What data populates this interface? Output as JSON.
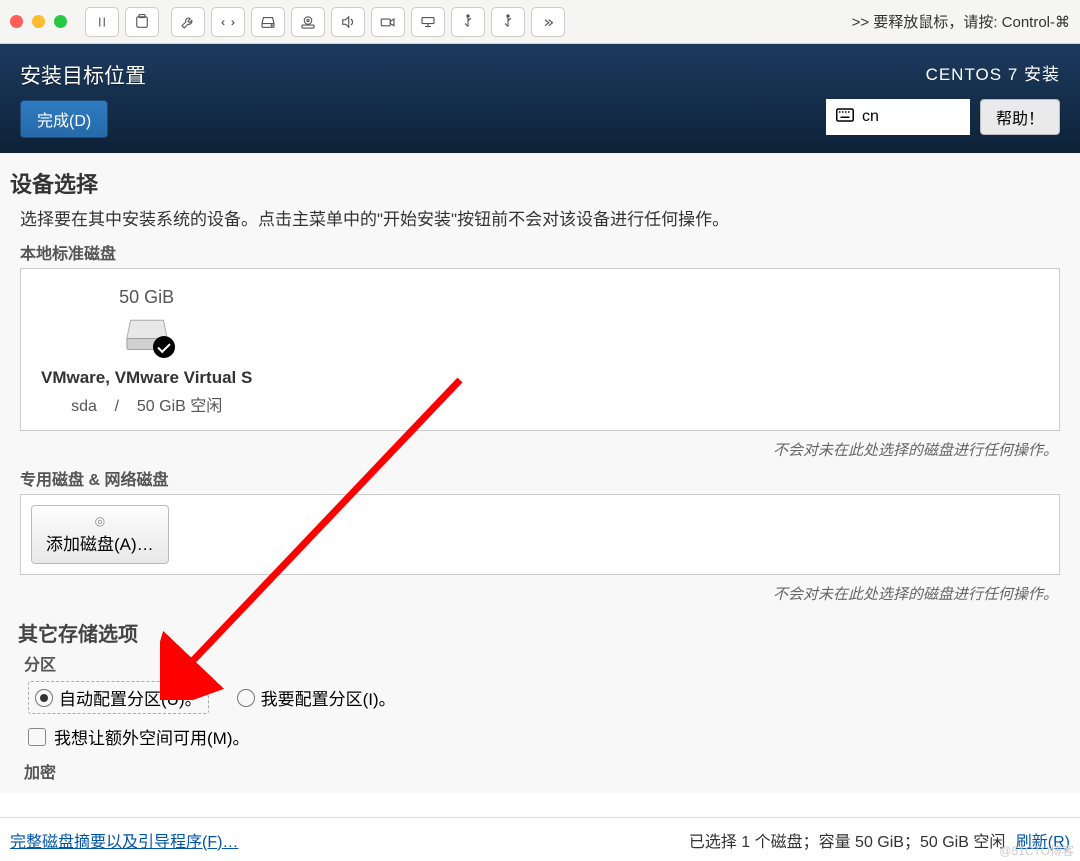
{
  "vm_toolbar": {
    "hint": ">>  要释放鼠标，请按: Control-⌘"
  },
  "header": {
    "title": "安装目标位置",
    "done_label": "完成(D)",
    "subtitle": "CENTOS 7 安装",
    "kb_layout": "cn",
    "help_label": "帮助！"
  },
  "device_selection": {
    "heading": "设备选择",
    "description": "选择要在其中安装系统的设备。点击主菜单中的\"开始安装\"按钮前不会对该设备进行任何操作。",
    "local_disks_label": "本地标准磁盘",
    "disk": {
      "size": "50 GiB",
      "name": "VMware, VMware Virtual S",
      "dev": "sda",
      "sep": "/",
      "free": "50 GiB 空闲"
    },
    "note": "不会对未在此处选择的磁盘进行任何操作。",
    "special_label": "专用磁盘 & 网络磁盘",
    "add_disk_label": "添加磁盘(A)…",
    "note2": "不会对未在此处选择的磁盘进行任何操作。"
  },
  "storage_options": {
    "heading": "其它存储选项",
    "partition_label": "分区",
    "auto_partition": "自动配置分区(U)。",
    "manual_partition": "我要配置分区(I)。",
    "extra_space": "我想让额外空间可用(M)。",
    "encrypt_label": "加密"
  },
  "bottom": {
    "summary_link": "完整磁盘摘要以及引导程序(F)…",
    "status": "已选择 1 个磁盘；容量 50 GiB；50 GiB 空闲",
    "refresh": "刷新(R)"
  },
  "watermark": "@51CTO博客"
}
